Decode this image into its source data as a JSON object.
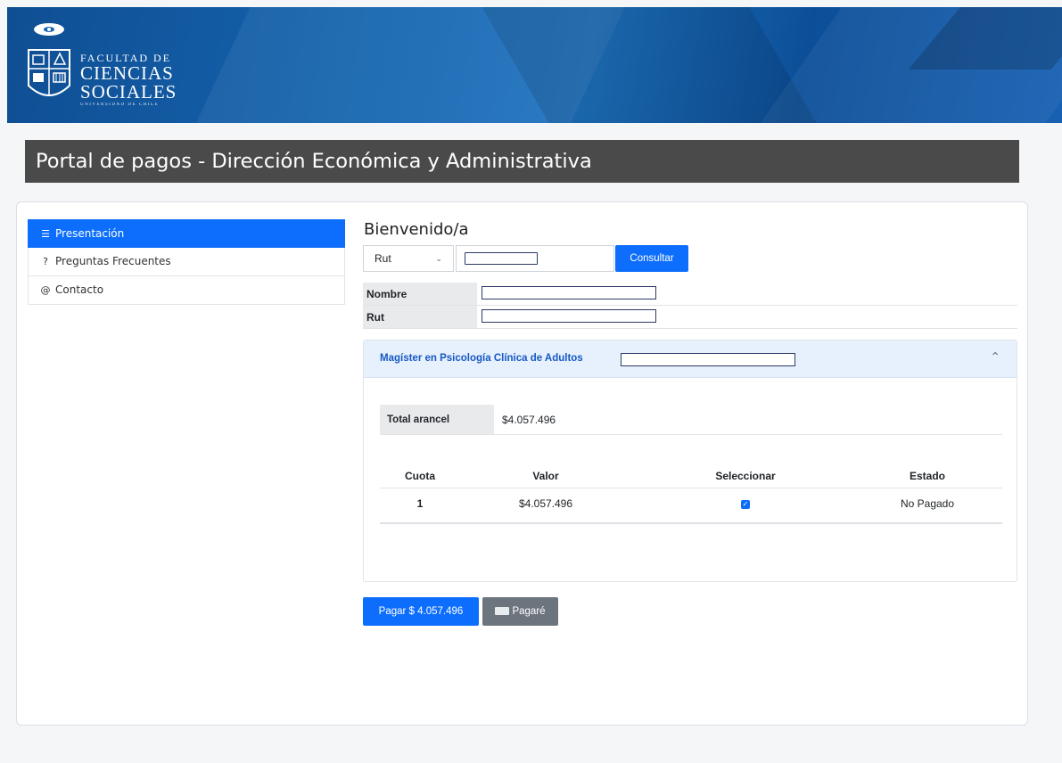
{
  "header": {
    "logo_line1": "FACULTAD DE",
    "logo_line2": "CIENCIAS",
    "logo_line3": "SOCIALES",
    "logo_line4": "UNIVERSIDAD DE CHILE",
    "page_title": "Portal de pagos - Dirección Económica y Administrativa"
  },
  "sidebar": {
    "items": [
      {
        "label": "Presentación",
        "icon": "list-icon",
        "active": true
      },
      {
        "label": "Preguntas Frecuentes",
        "icon": "question-circle-icon",
        "active": false
      },
      {
        "label": "Contacto",
        "icon": "at-sign-icon",
        "active": false
      }
    ]
  },
  "main": {
    "welcome": "Bienvenido/a",
    "search": {
      "select_value": "Rut",
      "input_value": "",
      "button_label": "Consultar"
    },
    "info": {
      "nombre_label": "Nombre",
      "nombre_value": "",
      "rut_label": "Rut",
      "rut_value": ""
    },
    "program": {
      "title": "Magíster en Psicología Clínica de Adultos",
      "total_label": "Total arancel",
      "total_value": "$4.057.496",
      "table": {
        "headers": [
          "Cuota",
          "Valor",
          "Seleccionar",
          "Estado"
        ],
        "rows": [
          {
            "cuota": "1",
            "valor": "$4.057.496",
            "selected": true,
            "estado": "No Pagado"
          }
        ]
      }
    },
    "actions": {
      "pay_label": "Pagar $ 4.057.496",
      "pagare_label": "Pagaré"
    }
  },
  "colors": {
    "primary": "#0d6efd",
    "title_bar": "#4a4a4a",
    "banner": "#1565b0",
    "secondary": "#6c757d"
  }
}
